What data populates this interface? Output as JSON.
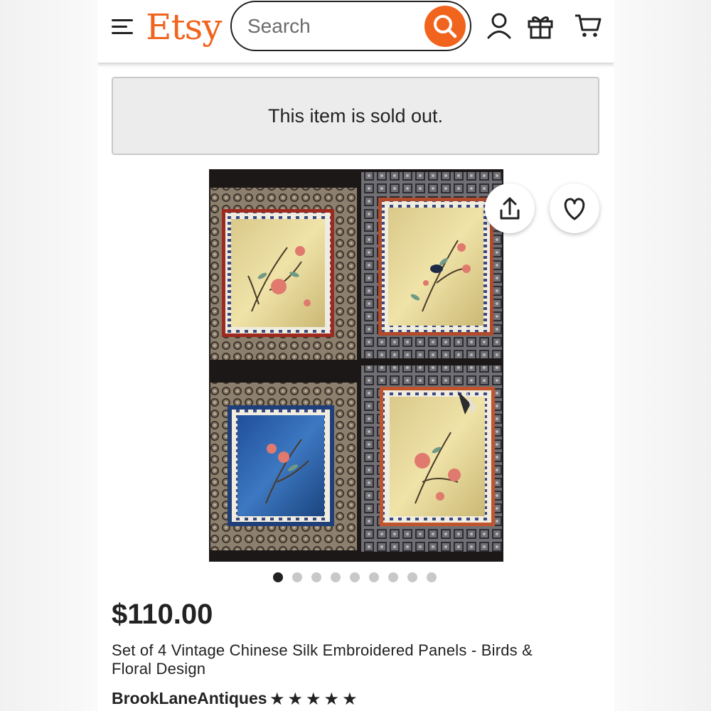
{
  "header": {
    "logo": "Etsy",
    "search_placeholder": "Search",
    "icons": [
      "menu-icon",
      "search-icon",
      "account-icon",
      "gift-icon",
      "cart-icon"
    ]
  },
  "banner": {
    "sold_out_text": "This item is sold out."
  },
  "listing": {
    "image_description_icons": [
      "share-icon",
      "heart-icon"
    ],
    "carousel": {
      "total": 9,
      "active_index": 0
    },
    "price": "$110.00",
    "title": "Set of 4 Vintage Chinese Silk Embroidered Panels - Birds & Floral Design",
    "shop_name": "BrookLaneAntiques",
    "rating_stars": 5
  },
  "colors": {
    "brand": "#f1641e",
    "text": "#222222",
    "banner_bg": "#ececec"
  }
}
